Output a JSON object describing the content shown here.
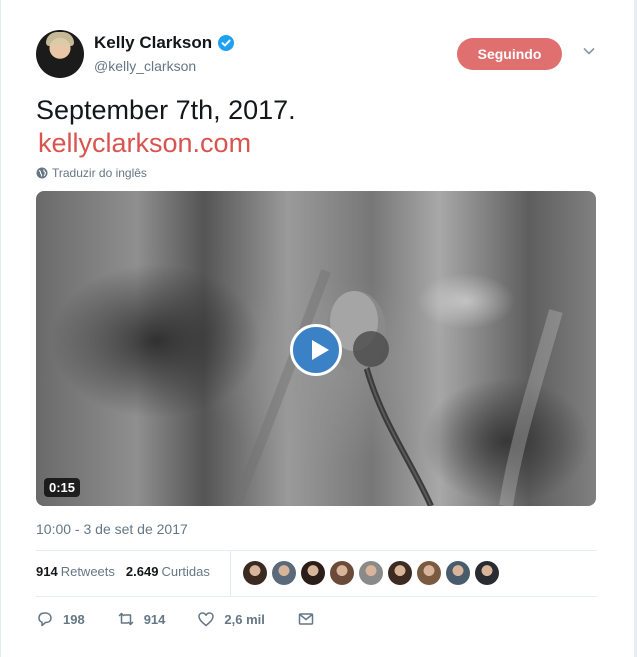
{
  "author": {
    "name": "Kelly Clarkson",
    "handle": "@kelly_clarkson",
    "verified": true
  },
  "follow_button": {
    "label": "Seguindo",
    "color": "#e0706f"
  },
  "tweet": {
    "text": "September 7th, 2017.",
    "link": "kellyclarkson.com",
    "link_color": "#d9534f",
    "translate_label": "Traduzir do inglês"
  },
  "video": {
    "duration": "0:15",
    "play_color": "#3a81c5"
  },
  "timestamp": "10:00 - 3 de set de 2017",
  "stats": {
    "retweets_count": "914",
    "retweets_label": "Retweets",
    "likes_count": "2.649",
    "likes_label": "Curtidas"
  },
  "liker_avatar_colors": [
    "#3b2a22",
    "#5a6a7a",
    "#2b1d18",
    "#6b4a3a",
    "#8a8a8a",
    "#3d2a20",
    "#7a5a40",
    "#4a5c6c",
    "#2a2a33"
  ],
  "actions": {
    "reply_count": "198",
    "retweet_count": "914",
    "like_count": "2,6 mil"
  }
}
